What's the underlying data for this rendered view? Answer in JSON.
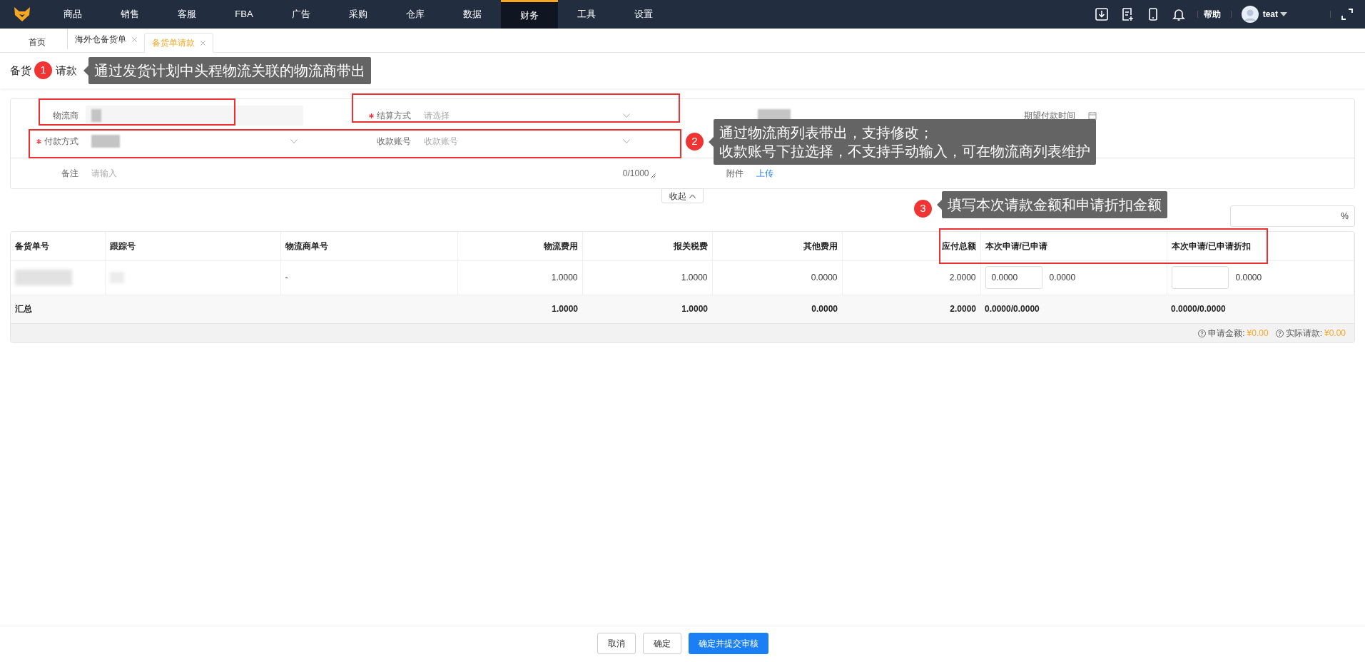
{
  "nav": {
    "items": [
      {
        "label": "商品",
        "selected": false
      },
      {
        "label": "销售",
        "selected": false
      },
      {
        "label": "客服",
        "selected": false
      },
      {
        "label": "FBA",
        "selected": false
      },
      {
        "label": "广告",
        "selected": false
      },
      {
        "label": "采购",
        "selected": false
      },
      {
        "label": "仓库",
        "selected": false
      },
      {
        "label": "数据",
        "selected": false
      },
      {
        "label": "财务",
        "selected": true
      },
      {
        "label": "工具",
        "selected": false
      },
      {
        "label": "设置",
        "selected": false
      }
    ],
    "help": "帮助",
    "user": "teat"
  },
  "tabs": [
    {
      "label": "首页",
      "closable": false,
      "selected": false
    },
    {
      "label": "海外仓备货单",
      "closable": true,
      "selected": false
    },
    {
      "label": "备货单请款",
      "closable": true,
      "selected": true
    }
  ],
  "page_title_visible": [
    "备货",
    "请款"
  ],
  "form": {
    "fields": [
      {
        "kind": "text",
        "label": "物流商",
        "required": false,
        "redacted": true
      },
      {
        "kind": "select",
        "label": "结算方式",
        "required": true,
        "placeholder": "请选择"
      },
      {
        "kind": "date",
        "label": "期望付款时间",
        "required": false
      },
      {
        "kind": "select",
        "label": "付款方式",
        "required": true,
        "redacted": true
      },
      {
        "kind": "select",
        "label": "收款账号",
        "required": false,
        "placeholder": "收款账号"
      },
      {
        "kind": "textarea",
        "label": "备注",
        "required": false,
        "placeholder": "请输入",
        "counter": "0/1000"
      },
      {
        "kind": "upload",
        "label": "附件",
        "required": false,
        "link": "上传"
      }
    ]
  },
  "collapse_button": "收起",
  "ratio_field": {
    "suffix": "%"
  },
  "table": {
    "columns": [
      "备货单号",
      "跟踪号",
      "物流商单号",
      "物流费用",
      "报关税费",
      "其他费用",
      "应付总额",
      "本次申请/已申请",
      "本次申请/已申请折扣"
    ],
    "rows": [
      {
        "cells": [
          {
            "kind": "redacted"
          },
          {
            "kind": "redacted"
          },
          {
            "kind": "text",
            "text": "-"
          },
          {
            "kind": "text",
            "text": "1.0000"
          },
          {
            "kind": "text",
            "text": "1.0000"
          },
          {
            "kind": "text",
            "text": "0.0000"
          },
          {
            "kind": "text",
            "text": "2.0000"
          },
          {
            "kind": "input",
            "value": "0.0000",
            "text": "0.0000"
          },
          {
            "kind": "input",
            "text": "0.0000"
          }
        ]
      }
    ],
    "summary": {
      "label": "汇总",
      "values": [
        "1.0000",
        "1.0000",
        "0.0000",
        "2.0000",
        "0.0000/0.0000",
        "0.0000/0.0000"
      ]
    },
    "footer": [
      {
        "label": "申请金额:",
        "amount": "¥0.00"
      },
      {
        "label": "实际请款:",
        "amount": "¥0.00"
      }
    ]
  },
  "annotations": [
    {
      "number": "1",
      "lines": [
        "通过发货计划中头程物流关联的物流商带出"
      ]
    },
    {
      "number": "2",
      "lines": [
        "通过物流商列表带出，支持修改；",
        "收款账号下拉选择，不支持手动输入，可在物流商列表维护"
      ]
    },
    {
      "number": "3",
      "lines": [
        "填写本次请款金额和申请折扣金额"
      ]
    }
  ],
  "buttons": [
    {
      "label": "取消",
      "kind": "default"
    },
    {
      "label": "确定",
      "kind": "default"
    },
    {
      "label": "确定并提交审核",
      "kind": "primary"
    }
  ]
}
